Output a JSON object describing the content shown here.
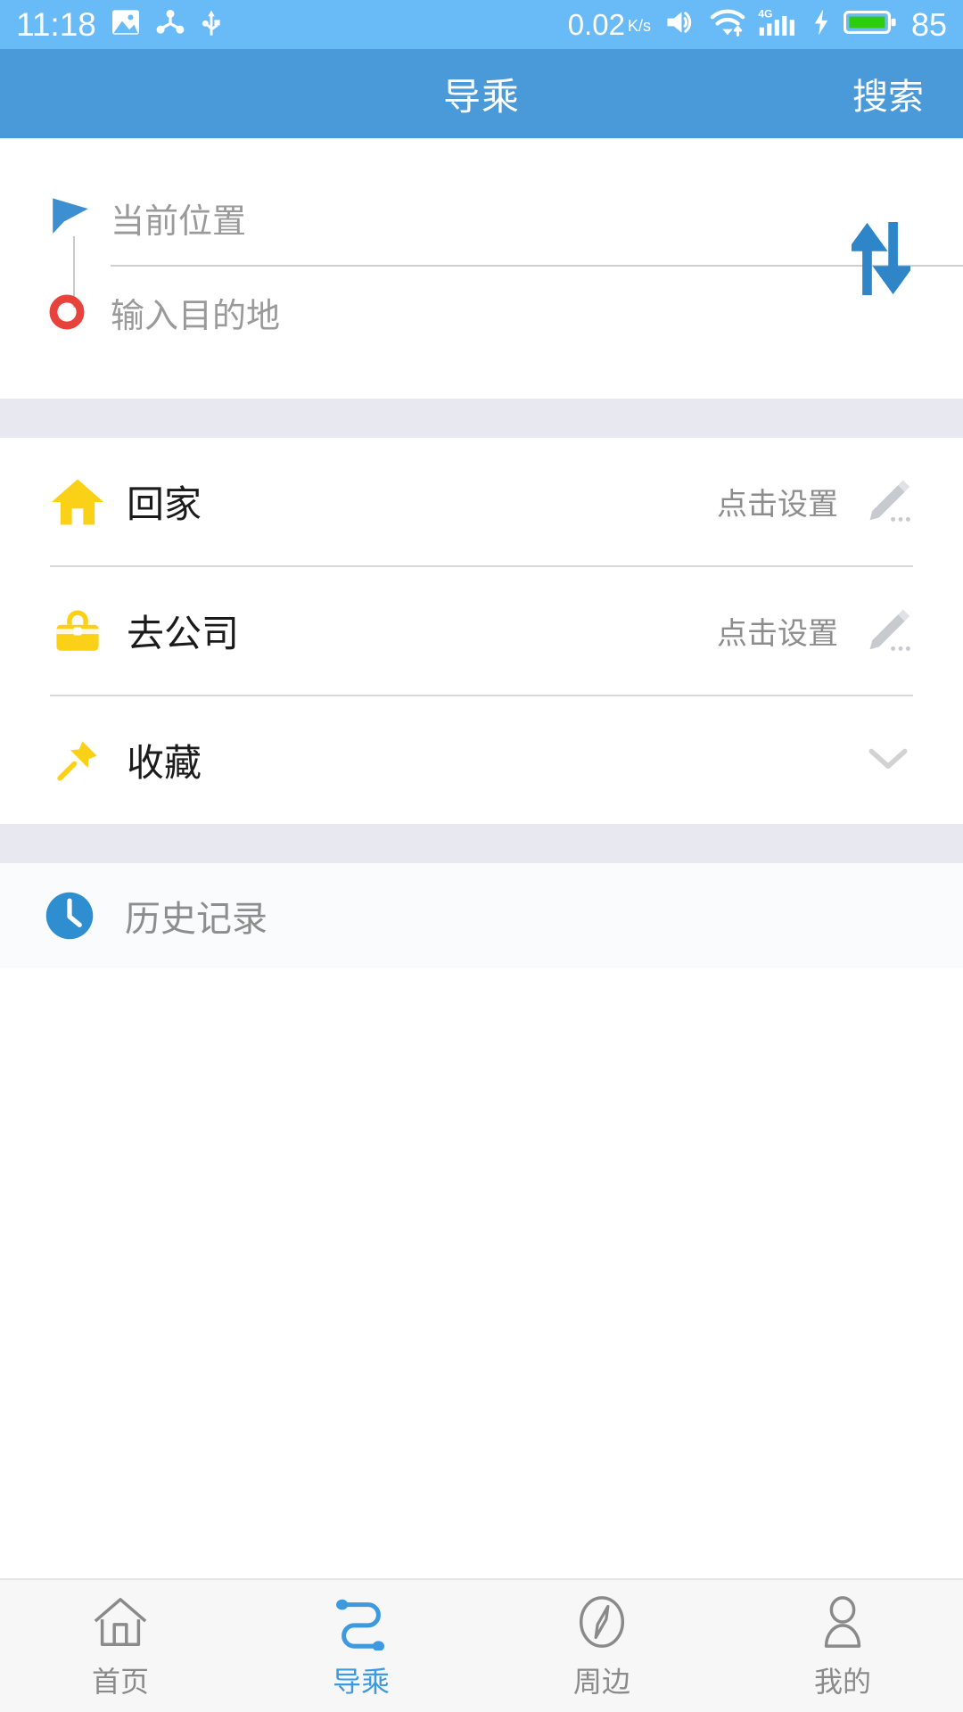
{
  "statusbar": {
    "time": "11:18",
    "icons_left": [
      "image-icon",
      "share-nodes-icon",
      "usb-icon"
    ],
    "network_speed": "0.02",
    "network_speed_unit": "K/s",
    "icons_right": [
      "mute-vibrate-icon",
      "wifi-icon",
      "signal-4g-icon",
      "charging-bolt-icon",
      "battery-icon"
    ],
    "signal_label": "4G",
    "battery_percent": "85",
    "bg_color": "#69bbf7",
    "fg_color": "#ffffff"
  },
  "header": {
    "title": "导乘",
    "action_label": "搜索",
    "bg_color": "#4a9ada"
  },
  "route": {
    "origin": {
      "placeholder": "当前位置",
      "icon": "navigation-arrow-icon",
      "icon_color": "#3d8fd1"
    },
    "destination": {
      "placeholder": "输入目的地",
      "icon": "destination-ring-icon",
      "icon_color": "#e8423d"
    },
    "swap": {
      "icon": "swap-vertical-arrows-icon",
      "color": "#2e86c8"
    }
  },
  "shortcuts": [
    {
      "label": "回家",
      "icon": "home-icon",
      "icon_color": "#fbd117",
      "hint": "点击设置",
      "action_icon": "pencil-edit-icon"
    },
    {
      "label": "去公司",
      "icon": "briefcase-icon",
      "icon_color": "#fbd117",
      "hint": "点击设置",
      "action_icon": "pencil-edit-icon"
    },
    {
      "label": "收藏",
      "icon": "pushpin-icon",
      "icon_color": "#fbd117",
      "hint": "",
      "action_icon": "chevron-down-icon"
    }
  ],
  "history": {
    "label": "历史记录",
    "icon": "clock-icon",
    "icon_color": "#2e8ed0"
  },
  "bottom_nav": {
    "active_index": 1,
    "active_color": "#3d9ae0",
    "inactive_color": "#8a8a8a",
    "items": [
      {
        "label": "首页",
        "icon": "home-outline-icon"
      },
      {
        "label": "导乘",
        "icon": "route-icon"
      },
      {
        "label": "周边",
        "icon": "compass-icon"
      },
      {
        "label": "我的",
        "icon": "person-icon"
      }
    ]
  }
}
